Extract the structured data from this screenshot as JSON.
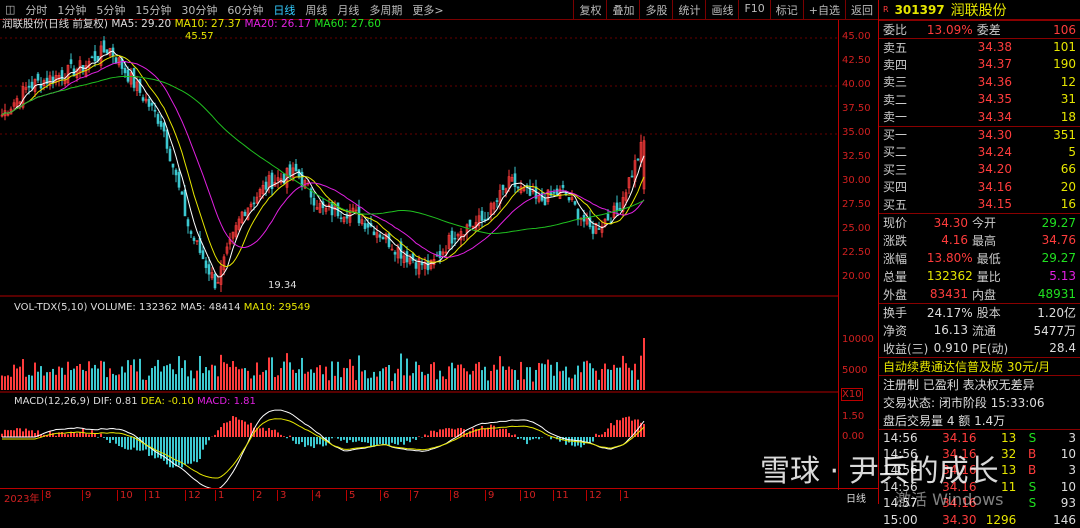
{
  "toolbar": {
    "tabs": [
      "分时",
      "1分钟",
      "5分钟",
      "15分钟",
      "30分钟",
      "60分钟",
      "日线",
      "周线",
      "月线",
      "多周期",
      "更多>"
    ],
    "active": "日线",
    "tools": [
      "复权",
      "叠加",
      "多股",
      "统计",
      "画线",
      "F10",
      "标记",
      "+自选",
      "返回"
    ]
  },
  "legend": {
    "name": "润联股份(日线 前复权)",
    "ma5": "MA5: 29.20",
    "ma10": "MA10: 27.37",
    "ma20": "MA20: 26.17",
    "ma60": "MA60: 27.60"
  },
  "price_axis": [
    "45.00",
    "42.50",
    "40.00",
    "37.50",
    "35.00",
    "32.50",
    "30.00",
    "27.50",
    "25.00",
    "22.50",
    "20.00"
  ],
  "vol_axis": [
    "10000",
    "5000",
    "X10"
  ],
  "macd_axis": [
    "1.50",
    "0.00"
  ],
  "annotations": {
    "high": "45.57",
    "low": "19.34"
  },
  "vol_legend": {
    "name": "VOL-TDX(5,10)",
    "volume": "VOLUME: 132362",
    "ma5": "MA5: 48414",
    "ma10": "MA10: 29549"
  },
  "macd_legend": {
    "name": "MACD(12,26,9)",
    "dif": "DIF: 0.81",
    "dea": "DEA: -0.10",
    "macd": "MACD: 1.81"
  },
  "dates": [
    "2023年",
    "8",
    "9",
    "10",
    "11",
    "12",
    "1",
    "2",
    "3",
    "4",
    "5",
    "6",
    "7",
    "8",
    "9",
    "10",
    "11",
    "12",
    "1"
  ],
  "period_label": "日线",
  "colors": {
    "up": "#ff3c3c",
    "down": "#3cc8d0",
    "ma5": "#ffffff",
    "ma10": "#e6e600",
    "ma20": "#e020e0",
    "ma60": "#20c020",
    "grid": "#b00000"
  },
  "chart_data": {
    "type": "candlestick",
    "approx_closes": [
      37,
      40,
      41,
      42,
      44,
      40,
      36,
      25,
      19.34,
      27,
      30,
      31,
      27,
      27,
      25,
      22.5,
      21,
      25,
      26,
      30,
      28,
      29,
      25,
      27,
      34.3
    ],
    "ylim": [
      19,
      46
    ]
  },
  "quote": {
    "code": "301397",
    "name": "润联股份",
    "wb": {
      "label": "委比",
      "value": "13.09%",
      "label2": "委差",
      "value2": "106"
    },
    "asks": [
      {
        "l": "卖五",
        "p": "34.38",
        "v": "101"
      },
      {
        "l": "卖四",
        "p": "34.37",
        "v": "190"
      },
      {
        "l": "卖三",
        "p": "34.36",
        "v": "12"
      },
      {
        "l": "卖二",
        "p": "34.35",
        "v": "31"
      },
      {
        "l": "卖一",
        "p": "34.34",
        "v": "18"
      }
    ],
    "bids": [
      {
        "l": "买一",
        "p": "34.30",
        "v": "351"
      },
      {
        "l": "买二",
        "p": "34.24",
        "v": "5"
      },
      {
        "l": "买三",
        "p": "34.20",
        "v": "66"
      },
      {
        "l": "买四",
        "p": "34.16",
        "v": "20"
      },
      {
        "l": "买五",
        "p": "34.15",
        "v": "16"
      }
    ],
    "stats": [
      {
        "l": "现价",
        "v": "34.30",
        "c": "r",
        "l2": "今开",
        "v2": "29.27",
        "c2": "g"
      },
      {
        "l": "涨跌",
        "v": "4.16",
        "c": "r",
        "l2": "最高",
        "v2": "34.76",
        "c2": "r"
      },
      {
        "l": "涨幅",
        "v": "13.80%",
        "c": "r",
        "l2": "最低",
        "v2": "29.27",
        "c2": "g"
      },
      {
        "l": "总量",
        "v": "132362",
        "c": "y",
        "l2": "量比",
        "v2": "5.13",
        "c2": "m"
      },
      {
        "l": "外盘",
        "v": "83431",
        "c": "r",
        "l2": "内盘",
        "v2": "48931",
        "c2": "g"
      }
    ],
    "fund": [
      {
        "l": "换手",
        "v": "24.17%",
        "l2": "股本",
        "v2": "1.20亿"
      },
      {
        "l": "净资",
        "v": "16.13",
        "l2": "流通",
        "v2": "5477万"
      },
      {
        "l": "收益(三)",
        "v": "0.910",
        "l2": "PE(动)",
        "v2": "28.4"
      }
    ],
    "promo": "自动续费通达信普及版  30元/月",
    "tags": "注册制 已盈利 表决权无差异",
    "status": "交易状态: 闭市阶段 15:33:06",
    "after": "盘后交易量 4 额 1.4万",
    "ticks": [
      {
        "t": "14:56",
        "p": "34.16",
        "v": "13",
        "s": "S",
        "n": "3"
      },
      {
        "t": "14:56",
        "p": "34.16",
        "v": "32",
        "s": "B",
        "n": "10"
      },
      {
        "t": "14:56",
        "p": "34.16",
        "v": "13",
        "s": "B",
        "n": "3"
      },
      {
        "t": "14:56",
        "p": "34.16",
        "v": "11",
        "s": "S",
        "n": "10"
      },
      {
        "t": "14:57",
        "p": "34.16",
        "v": "",
        "s": "S",
        "n": "93"
      },
      {
        "t": "15:00",
        "p": "34.30",
        "v": "1296",
        "s": "",
        "n": "146"
      }
    ]
  },
  "watermark": {
    "text1": "雪球",
    "text2": "尹兵的成长",
    "text3": "激活 Windows"
  }
}
